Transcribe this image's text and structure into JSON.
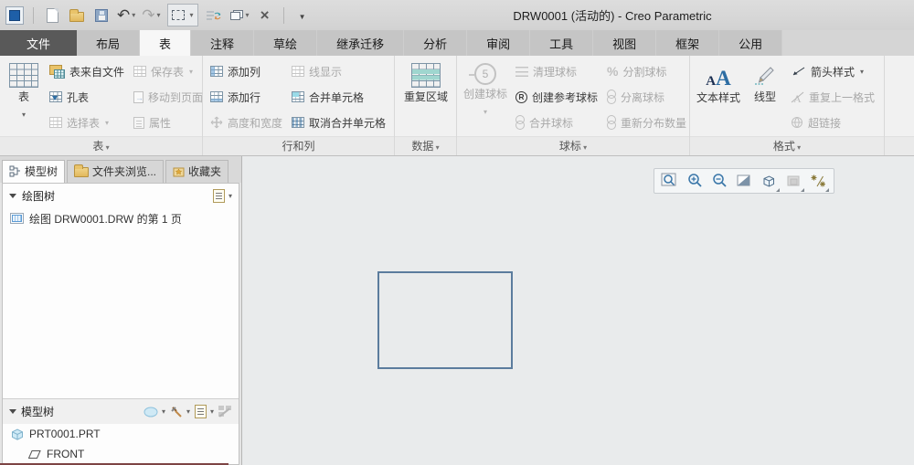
{
  "window": {
    "title": "DRW0001 (活动的) - Creo Parametric"
  },
  "tabs": {
    "file": "文件",
    "items": [
      "布局",
      "表",
      "注释",
      "草绘",
      "继承迁移",
      "分析",
      "审阅",
      "工具",
      "视图",
      "框架",
      "公用"
    ],
    "active": "表"
  },
  "ribbon": {
    "table": {
      "label": "表",
      "big": "表",
      "from_file": "表来自文件",
      "save": "保存表",
      "hole": "孔表",
      "move": "移动到页面",
      "select": "选择表",
      "props": "属性"
    },
    "rowcol": {
      "label": "行和列",
      "add_col": "添加列",
      "line_disp": "线显示",
      "add_row": "添加行",
      "merge": "合并单元格",
      "hw": "高度和宽度",
      "unmerge": "取消合并单元格"
    },
    "data": {
      "label": "数据",
      "repeat": "重复区域"
    },
    "balloon": {
      "label": "球标",
      "create": "创建球标",
      "num": "5",
      "clean": "清理球标",
      "split": "分割球标",
      "ref": "创建参考球标",
      "detach": "分离球标",
      "merge": "合并球标",
      "redist": "重新分布数量"
    },
    "format": {
      "label": "格式",
      "text_style": "文本样式",
      "a1": "A",
      "a2": "A",
      "line_style": "线型",
      "arrow": "箭头样式",
      "repeat_fmt": "重复上一格式",
      "link": "超链接"
    }
  },
  "panel": {
    "tab_model": "模型树",
    "tab_folder": "文件夹浏览...",
    "tab_fav": "收藏夹",
    "dtree_header": "绘图树",
    "dtree_item": "绘图 DRW0001.DRW 的第 1 页",
    "mtree_header": "模型树",
    "mtree_item1": "PRT0001.PRT",
    "mtree_item2": "FRONT"
  },
  "icons": {
    "quick_access": [
      "app-window-icon",
      "new-file-icon",
      "open-file-icon",
      "save-icon",
      "undo-icon",
      "redo-icon",
      "selection-filter-icon",
      "regenerate-icon",
      "window-cascade-icon",
      "close-window-icon",
      "qat-more-icon"
    ],
    "canvas_toolbar": [
      "zoom-selection-icon",
      "zoom-in-icon",
      "zoom-out-icon",
      "refit-icon",
      "saved-orientations-icon",
      "named-views-icon",
      "datum-display-icon"
    ]
  },
  "colors": {
    "accent": "#2d6da3",
    "rect_border": "#5b7c9d",
    "canvas_bg": "#e9ebec",
    "tab_dark": "#595959",
    "disabled_text": "#a9a9a9"
  }
}
